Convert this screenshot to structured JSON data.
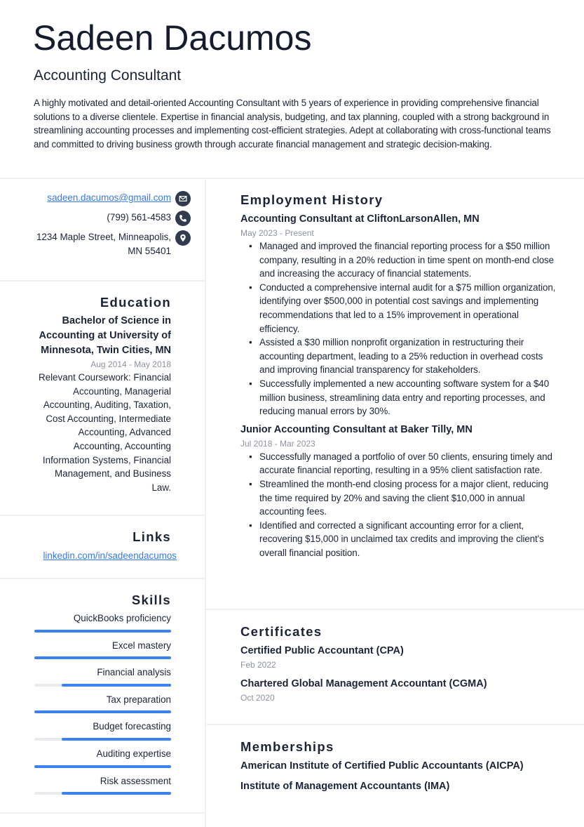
{
  "header": {
    "name": "Sadeen Dacumos",
    "role": "Accounting Consultant",
    "summary": "A highly motivated and detail-oriented Accounting Consultant with 5 years of experience in providing comprehensive financial solutions to a diverse clientele. Expertise in financial analysis, budgeting, and tax planning, coupled with a strong background in streamlining accounting processes and implementing cost-efficient strategies. Adept at collaborating with cross-functional teams and committed to driving business growth through accurate financial management and strategic decision-making."
  },
  "contact": {
    "email": "sadeen.dacumos@gmail.com",
    "phone": "(799) 561-4583",
    "address_line1": "1234 Maple Street, Minneapolis,",
    "address_line2": "MN 55401",
    "icons": [
      "envelope-icon",
      "phone-icon",
      "map-pin-icon"
    ]
  },
  "education": {
    "heading": "Education",
    "degree": "Bachelor of Science in Accounting at University of Minnesota, Twin Cities, MN",
    "dates": "Aug 2014 - May 2018",
    "coursework": "Relevant Coursework: Financial Accounting, Managerial Accounting, Auditing, Taxation, Cost Accounting, Intermediate Accounting, Advanced Accounting, Accounting Information Systems, Financial Management, and Business Law."
  },
  "links": {
    "heading": "Links",
    "items": [
      {
        "label": "linkedin.com/in/sadeendacumos"
      }
    ]
  },
  "skills": {
    "heading": "Skills",
    "items": [
      {
        "label": "QuickBooks proficiency",
        "level": 1.0
      },
      {
        "label": "Excel mastery",
        "level": 1.0
      },
      {
        "label": "Financial analysis",
        "level": 0.8
      },
      {
        "label": "Tax preparation",
        "level": 1.0
      },
      {
        "label": "Budget forecasting",
        "level": 0.8
      },
      {
        "label": "Auditing expertise",
        "level": 1.0
      },
      {
        "label": "Risk assessment",
        "level": 0.8
      }
    ],
    "colors": {
      "fill": "#3b82f0",
      "track": "#e8eaed"
    }
  },
  "employment": {
    "heading": "Employment History",
    "jobs": [
      {
        "title": "Accounting Consultant at CliftonLarsonAllen, MN",
        "dates": "May 2023 - Present",
        "bullets": [
          "Managed and improved the financial reporting process for a $50 million company, resulting in a 20% reduction in time spent on month-end close and increasing the accuracy of financial statements.",
          "Conducted a comprehensive internal audit for a $75 million organization, identifying over $500,000 in potential cost savings and implementing recommendations that led to a 15% improvement in operational efficiency.",
          "Assisted a $30 million nonprofit organization in restructuring their accounting department, leading to a 25% reduction in overhead costs and improving financial transparency for stakeholders.",
          "Successfully implemented a new accounting software system for a $40 million business, streamlining data entry and reporting processes, and reducing manual errors by 30%."
        ]
      },
      {
        "title": "Junior Accounting Consultant at Baker Tilly, MN",
        "dates": "Jul 2018 - Mar 2023",
        "bullets": [
          "Successfully managed a portfolio of over 50 clients, ensuring timely and accurate financial reporting, resulting in a 95% client satisfaction rate.",
          "Streamlined the month-end closing process for a major client, reducing the time required by 20% and saving the client $10,000 in annual accounting fees.",
          "Identified and corrected a significant accounting error for a client, recovering $15,000 in unclaimed tax credits and improving the client's overall financial position."
        ]
      }
    ]
  },
  "certificates": {
    "heading": "Certificates",
    "items": [
      {
        "title": "Certified Public Accountant (CPA)",
        "date": "Feb 2022"
      },
      {
        "title": "Chartered Global Management Accountant (CGMA)",
        "date": "Oct 2020"
      }
    ]
  },
  "memberships": {
    "heading": "Memberships",
    "items": [
      "American Institute of Certified Public Accountants (AICPA)",
      "Institute of Management Accountants (IMA)"
    ]
  },
  "colors": {
    "text": "#1b2437",
    "muted": "#8d929c",
    "link": "#3778e6",
    "icon_bg": "#313b4e",
    "divider": "#eef0f3"
  }
}
